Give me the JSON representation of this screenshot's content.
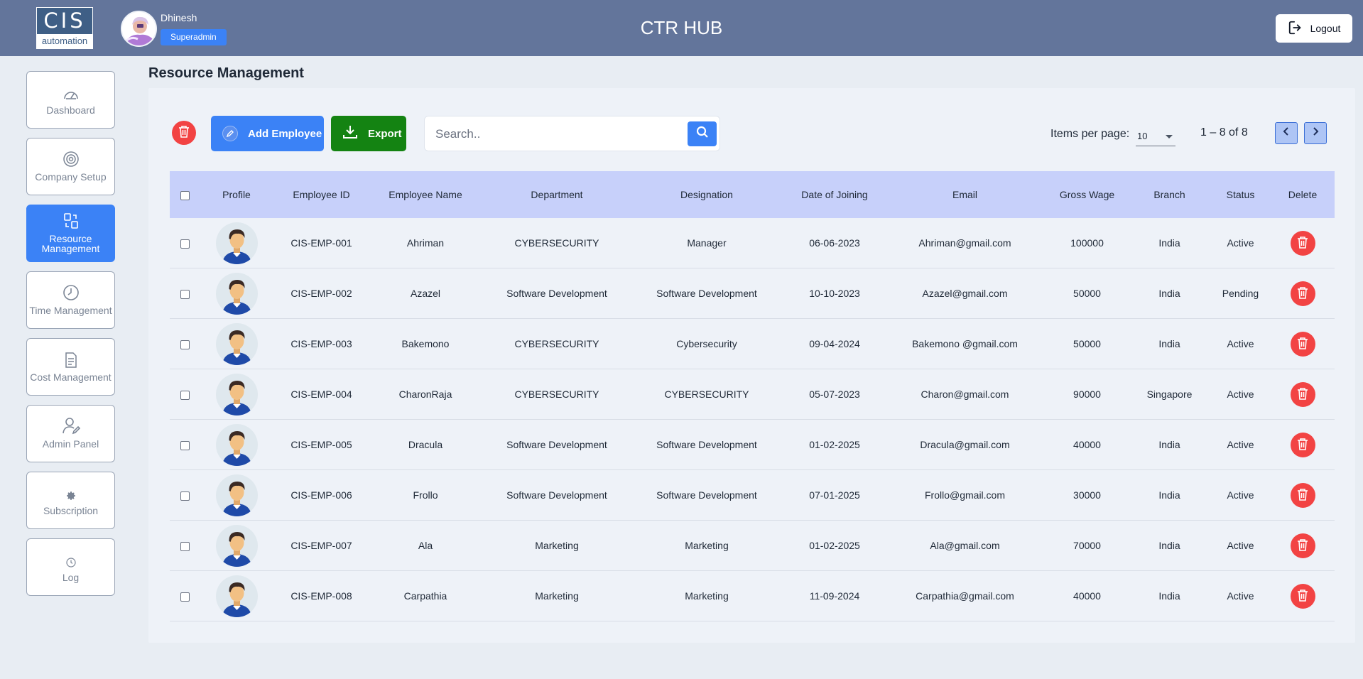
{
  "header": {
    "logo_top": "CIS",
    "logo_bottom": "automation",
    "user_name": "Dhinesh",
    "role": "Superadmin",
    "app_title": "CTR HUB",
    "logout_label": "Logout"
  },
  "sidebar": {
    "items": [
      {
        "label": "Dashboard",
        "icon": "gauge-icon"
      },
      {
        "label": "Company Setup",
        "icon": "settings-circle-icon"
      },
      {
        "label": "Resource Management",
        "icon": "resource-icon",
        "active": true
      },
      {
        "label": "Time Management",
        "icon": "clock-icon"
      },
      {
        "label": "Cost Management",
        "icon": "document-icon"
      },
      {
        "label": "Admin Panel",
        "icon": "user-edit-icon"
      },
      {
        "label": "Subscription",
        "icon": "gear-icon"
      },
      {
        "label": "Log",
        "icon": "history-icon"
      }
    ]
  },
  "main": {
    "page_title": "Resource Management",
    "toolbar": {
      "add_label": "Add Employee",
      "export_label": "Export",
      "search_placeholder": "Search..",
      "items_per_page_label": "Items per page:",
      "items_per_page_value": "10",
      "range_text": "1 – 8 of 8"
    },
    "table": {
      "columns": [
        "Profile",
        "Employee ID",
        "Employee Name",
        "Department",
        "Designation",
        "Date of Joining",
        "Email",
        "Gross Wage",
        "Branch",
        "Status",
        "Delete"
      ],
      "rows": [
        {
          "id": "CIS-EMP-001",
          "name": "Ahriman",
          "dept": "CYBERSECURITY",
          "desg": "Manager",
          "doj": "06-06-2023",
          "email": "Ahriman@gmail.com",
          "wage": "100000",
          "branch": "India",
          "status": "Active"
        },
        {
          "id": "CIS-EMP-002",
          "name": "Azazel",
          "dept": "Software Development",
          "desg": "Software Development",
          "doj": "10-10-2023",
          "email": "Azazel@gmail.com",
          "wage": "50000",
          "branch": "India",
          "status": "Pending"
        },
        {
          "id": "CIS-EMP-003",
          "name": "Bakemono",
          "dept": "CYBERSECURITY",
          "desg": "Cybersecurity",
          "doj": "09-04-2024",
          "email": "Bakemono @gmail.com",
          "wage": "50000",
          "branch": "India",
          "status": "Active"
        },
        {
          "id": "CIS-EMP-004",
          "name": "CharonRaja",
          "dept": "CYBERSECURITY",
          "desg": "CYBERSECURITY",
          "doj": "05-07-2023",
          "email": "Charon@gmail.com",
          "wage": "90000",
          "branch": "Singapore",
          "status": "Active"
        },
        {
          "id": "CIS-EMP-005",
          "name": "Dracula",
          "dept": "Software Development",
          "desg": "Software Development",
          "doj": "01-02-2025",
          "email": "Dracula@gmail.com",
          "wage": "40000",
          "branch": "India",
          "status": "Active"
        },
        {
          "id": "CIS-EMP-006",
          "name": "Frollo",
          "dept": "Software Development",
          "desg": "Software Development",
          "doj": "07-01-2025",
          "email": "Frollo@gmail.com",
          "wage": "30000",
          "branch": "India",
          "status": "Active"
        },
        {
          "id": "CIS-EMP-007",
          "name": "Ala",
          "dept": "Marketing",
          "desg": "Marketing",
          "doj": "01-02-2025",
          "email": "Ala@gmail.com",
          "wage": "70000",
          "branch": "India",
          "status": "Active"
        },
        {
          "id": "CIS-EMP-008",
          "name": "Carpathia",
          "dept": "Marketing",
          "desg": "Marketing",
          "doj": "11-09-2024",
          "email": "Carpathia@gmail.com",
          "wage": "40000",
          "branch": "India",
          "status": "Active"
        }
      ]
    }
  },
  "colors": {
    "header_bg": "#63759b",
    "accent": "#3b82f6",
    "export_green": "#148312",
    "danger": "#f24343",
    "table_header": "#c7d0fa"
  }
}
